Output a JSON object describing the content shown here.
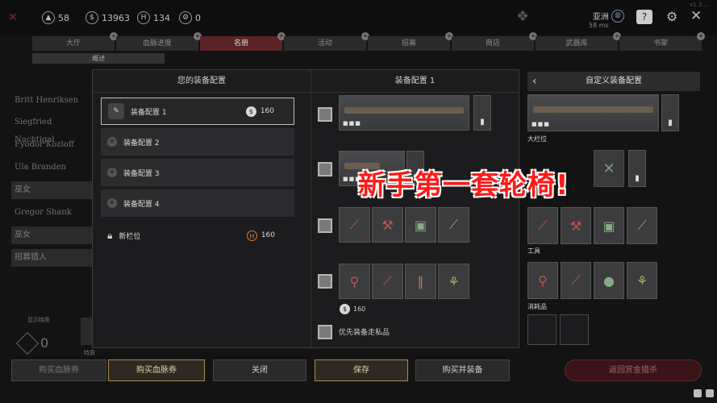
{
  "topbar": {
    "currencies": [
      {
        "icon": "rank-icon",
        "value": "58"
      },
      {
        "icon": "hunt-dollar-icon",
        "value": "13963"
      },
      {
        "icon": "blood-bond-icon",
        "value": "134"
      },
      {
        "icon": "gear-token-icon",
        "value": "0"
      }
    ],
    "region": "亚洲",
    "ping": "58 ms",
    "version": "v1.3..."
  },
  "tabs": [
    {
      "label": "大厅",
      "active": false
    },
    {
      "label": "血脉进度",
      "active": false
    },
    {
      "label": "名册",
      "active": true
    },
    {
      "label": "活动",
      "active": false
    },
    {
      "label": "招募",
      "active": false
    },
    {
      "label": "商店",
      "active": false
    },
    {
      "label": "武器库",
      "active": false
    },
    {
      "label": "书架",
      "active": false
    }
  ],
  "subtabs": [
    "概述",
    "",
    "",
    "",
    ""
  ],
  "roster": [
    {
      "name": "Britt Henriksen",
      "hl": false
    },
    {
      "name": "Siegfried Nachtigal",
      "hl": false
    },
    {
      "name": "Fyodor Kozloff",
      "hl": false
    },
    {
      "name": "Ula Branden",
      "hl": false
    },
    {
      "name": "巫女",
      "hl": true
    },
    {
      "name": "Gregor Shank",
      "hl": false
    },
    {
      "name": "巫女",
      "hl": true
    },
    {
      "name": "招募猎人",
      "hl": true
    }
  ],
  "left_bottom": {
    "label": "显示特质",
    "count": "0",
    "trait_label": "特质"
  },
  "dialog": {
    "left_title": "您的装备配置",
    "right_title": "装备配置 1",
    "loadouts": [
      {
        "label": "装备配置 1",
        "cost": "160",
        "selected": true
      },
      {
        "label": "装备配置 2"
      },
      {
        "label": "装备配置 3"
      },
      {
        "label": "装备配置 4"
      }
    ],
    "new_slot": {
      "label": "新栏位",
      "cost": "160"
    },
    "consumable_cost": "160",
    "priority_label": "优先装备走私品"
  },
  "right_panel": {
    "title": "自定义装备配置",
    "large_slot": "大栏位",
    "tools": "工具",
    "consumables": "消耗品"
  },
  "buttons": {
    "buy_bloodline_dim": "购买血脉券",
    "buy_bloodline": "购买血脉券",
    "close": "关闭",
    "save": "保存",
    "buy_equip": "购买并装备",
    "return": "返回赏金猎杀"
  },
  "overlay": "新手第一套轮椅!"
}
